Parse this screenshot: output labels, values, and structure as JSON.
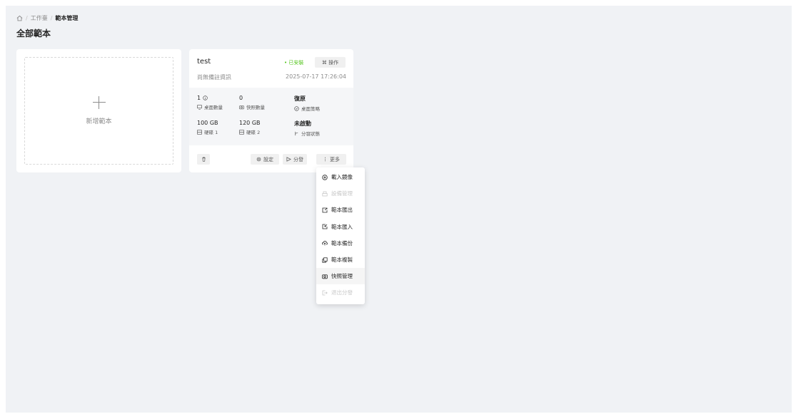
{
  "breadcrumb": {
    "home_icon": "home-icon",
    "items": [
      "工作臺",
      "範本管理"
    ]
  },
  "page_title": "全部範本",
  "add_card": {
    "label": "新增範本"
  },
  "template": {
    "name": "test",
    "status": "• 已安裝",
    "status_color": "#52c41a",
    "operate_label": "⌘ 操作",
    "remark": "尚無備註資訊",
    "time": "2025-07-17 17:26:04",
    "stats": [
      {
        "value": "1",
        "label": "桌面數量",
        "icon": "monitor-icon",
        "value_icon": "info-icon"
      },
      {
        "value": "0",
        "label": "快照數量",
        "icon": "camera-icon"
      },
      {
        "value": "復原",
        "label": "桌面策略",
        "icon": "policy-icon"
      },
      {
        "value": "100 GB",
        "label": "硬碟 1",
        "icon": "disk-icon"
      },
      {
        "value": "120 GB",
        "label": "硬碟 2",
        "icon": "disk-icon"
      },
      {
        "value": "未啟動",
        "label": "分發狀態",
        "icon": "branch-icon"
      }
    ],
    "footer": {
      "settings_label": "設定",
      "distribute_label": "分發",
      "more_label": "更多"
    }
  },
  "more_menu": {
    "items": [
      {
        "label": "載入鏡像",
        "icon": "disc-icon",
        "disabled": false
      },
      {
        "label": "設備管理",
        "icon": "device-icon",
        "disabled": true
      },
      {
        "label": "範本匯出",
        "icon": "export-icon",
        "disabled": false
      },
      {
        "label": "範本匯入",
        "icon": "import-icon",
        "disabled": false
      },
      {
        "label": "範本備份",
        "icon": "cloud-backup-icon",
        "disabled": false
      },
      {
        "label": "範本複製",
        "icon": "copy-icon",
        "disabled": false
      },
      {
        "label": "快照管理",
        "icon": "camera-icon",
        "disabled": false,
        "hovered": true
      },
      {
        "label": "退出分發",
        "icon": "logout-icon",
        "disabled": true
      }
    ]
  }
}
